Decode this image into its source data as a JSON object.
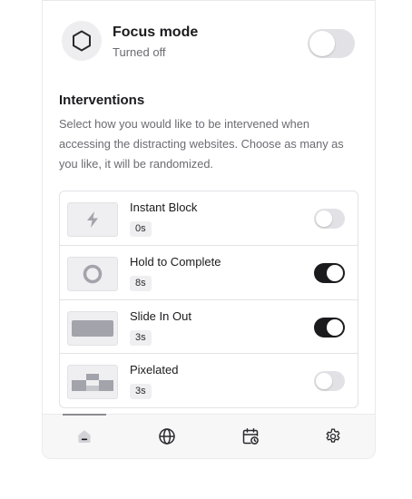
{
  "focus": {
    "title": "Focus mode",
    "status": "Turned off",
    "enabled": false,
    "icon": "hexagon-icon"
  },
  "interventions": {
    "title": "Interventions",
    "description": "Select how you would like to be intervened when accessing the distracting websites. Choose as many as you like, it will be randomized.",
    "items": [
      {
        "name": "Instant Block",
        "duration": "0s",
        "enabled": false,
        "icon": "lightning-icon"
      },
      {
        "name": "Hold to Complete",
        "duration": "8s",
        "enabled": true,
        "icon": "ring-icon"
      },
      {
        "name": "Slide In Out",
        "duration": "3s",
        "enabled": true,
        "icon": "bar-icon"
      },
      {
        "name": "Pixelated",
        "duration": "3s",
        "enabled": false,
        "icon": "pixel-blocks-icon"
      }
    ]
  },
  "nav": {
    "items": [
      {
        "icon": "home-icon",
        "active": true
      },
      {
        "icon": "globe-icon",
        "active": false
      },
      {
        "icon": "calendar-clock-icon",
        "active": false
      },
      {
        "icon": "gear-icon",
        "active": false
      }
    ]
  },
  "colors": {
    "toggle_on": "#1b1b1e",
    "toggle_off": "#e2e2e6",
    "muted_text": "#6b6b72",
    "icon_gray": "#a3a3ab"
  }
}
